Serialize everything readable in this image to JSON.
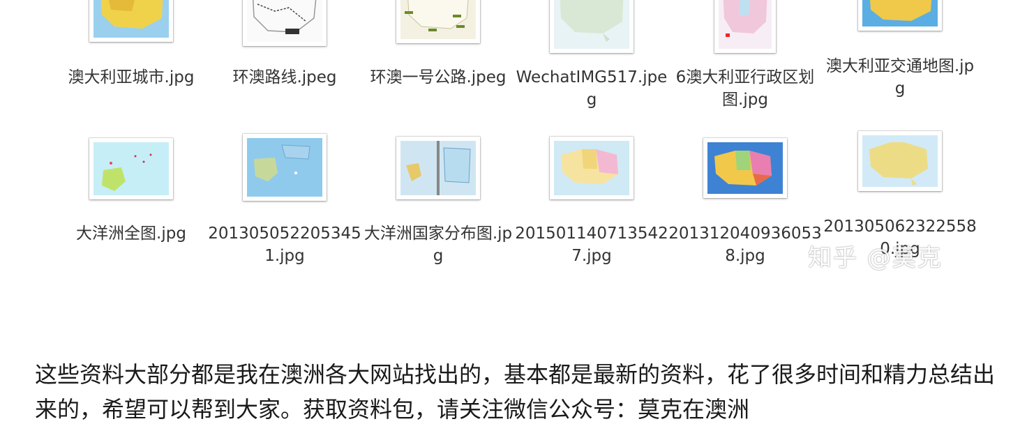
{
  "files_row1": [
    {
      "name": "澳大利亚城市.jpg"
    },
    {
      "name": "环澳路线.jpeg"
    },
    {
      "name": "环澳一号公路.jpeg"
    },
    {
      "name": "WechatIMG517.jpeg"
    },
    {
      "name": "6澳大利亚行政区划图.jpg"
    },
    {
      "name": "澳大利亚交通地图.jpg"
    }
  ],
  "files_row2": [
    {
      "name": "大洋洲全图.jpg"
    },
    {
      "name": "2013050522053451.jpg"
    },
    {
      "name": "大洋洲国家分布图.jpg"
    },
    {
      "name": "2015011407135427.jpg"
    },
    {
      "name": "2013120409360538.jpg"
    },
    {
      "name": "2013050623225580.jpg"
    }
  ],
  "watermark": "知乎 @莫克",
  "paragraph": "这些资料大部分都是我在澳洲各大网站找出的，基本都是最新的资料，花了很多时间和精力总结出来的，希望可以帮到大家。获取资料包，请关注微信公众号：莫克在澳洲"
}
